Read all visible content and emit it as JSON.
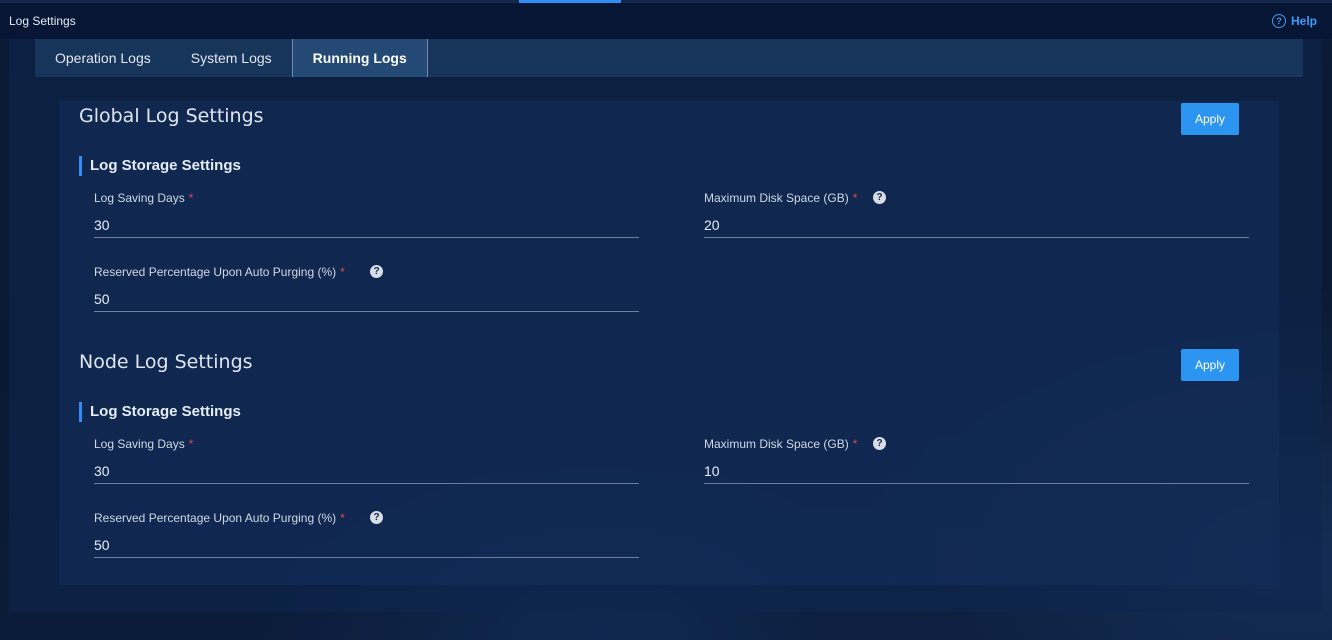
{
  "header": {
    "title": "Log Settings",
    "help_label": "Help"
  },
  "tabs": [
    {
      "label": "Operation Logs",
      "active": false
    },
    {
      "label": "System Logs",
      "active": false
    },
    {
      "label": "Running Logs",
      "active": true
    }
  ],
  "global": {
    "title": "Global Log Settings",
    "apply_label": "Apply",
    "storage_title": "Log Storage Settings",
    "saving_days": {
      "label": "Log Saving Days",
      "required": "*",
      "value": "30"
    },
    "max_disk": {
      "label": "Maximum Disk Space (GB)",
      "required": "*",
      "value": "20"
    },
    "reserved": {
      "label": "Reserved Percentage Upon Auto Purging (%)",
      "required": "*",
      "value": "50"
    }
  },
  "node": {
    "title": "Node Log Settings",
    "apply_label": "Apply",
    "storage_title": "Log Storage Settings",
    "saving_days": {
      "label": "Log Saving Days",
      "required": "*",
      "value": "30"
    },
    "max_disk": {
      "label": "Maximum Disk Space (GB)",
      "required": "*",
      "value": "10"
    },
    "reserved": {
      "label": "Reserved Percentage Upon Auto Purging (%)",
      "required": "*",
      "value": "50"
    }
  },
  "colors": {
    "accent": "#2f8ff5",
    "button": "#2c95f2",
    "required": "#e0454e"
  }
}
